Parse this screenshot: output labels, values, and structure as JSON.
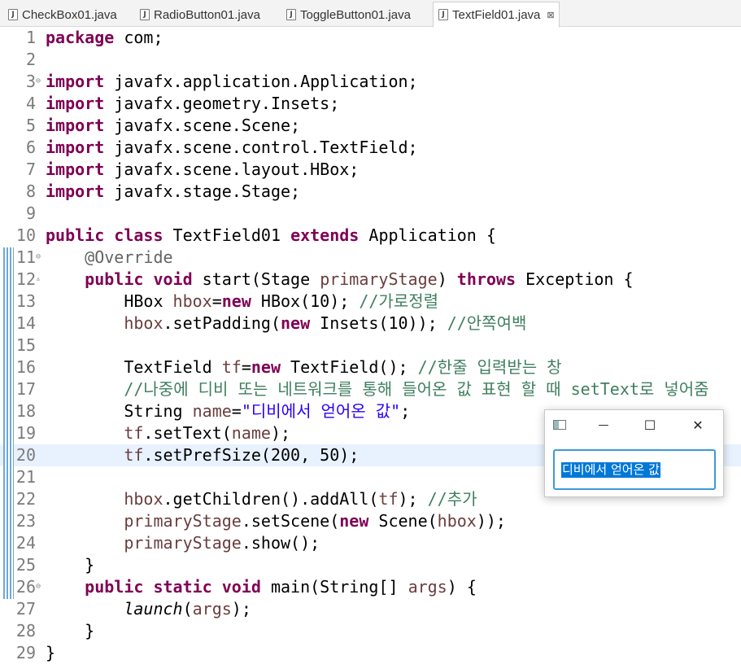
{
  "tabs": [
    {
      "label": "CheckBox01.java",
      "active": false
    },
    {
      "label": "RadioButton01.java",
      "active": false
    },
    {
      "label": "ToggleButton01.java",
      "active": false
    },
    {
      "label": "TextField01.java",
      "active": true,
      "close": "⊠"
    }
  ],
  "editor": {
    "current_line": 20,
    "lines": [
      {
        "n": "1",
        "tokens": [
          {
            "t": "package",
            "c": "kw"
          },
          {
            "t": " com;"
          }
        ]
      },
      {
        "n": "2",
        "tokens": []
      },
      {
        "n": "3",
        "fold": "⊖",
        "tokens": [
          {
            "t": "import",
            "c": "kw"
          },
          {
            "t": " javafx.application.Application;"
          }
        ]
      },
      {
        "n": "4",
        "tokens": [
          {
            "t": "import",
            "c": "kw"
          },
          {
            "t": " javafx.geometry.Insets;"
          }
        ]
      },
      {
        "n": "5",
        "tokens": [
          {
            "t": "import",
            "c": "kw"
          },
          {
            "t": " javafx.scene.Scene;"
          }
        ]
      },
      {
        "n": "6",
        "tokens": [
          {
            "t": "import",
            "c": "kw"
          },
          {
            "t": " javafx.scene.control.TextField;"
          }
        ]
      },
      {
        "n": "7",
        "tokens": [
          {
            "t": "import",
            "c": "kw"
          },
          {
            "t": " javafx.scene.layout.HBox;"
          }
        ]
      },
      {
        "n": "8",
        "tokens": [
          {
            "t": "import",
            "c": "kw"
          },
          {
            "t": " javafx.stage.Stage;"
          }
        ]
      },
      {
        "n": "9",
        "tokens": []
      },
      {
        "n": "10",
        "tokens": [
          {
            "t": "public",
            "c": "kw"
          },
          {
            "t": " "
          },
          {
            "t": "class",
            "c": "kw"
          },
          {
            "t": " TextField01 "
          },
          {
            "t": "extends",
            "c": "kw"
          },
          {
            "t": " Application {"
          }
        ]
      },
      {
        "n": "11",
        "fold": "⊖",
        "tokens": [
          {
            "t": "    "
          },
          {
            "t": "@Override",
            "c": "ann"
          }
        ]
      },
      {
        "n": "12",
        "fold": "▵",
        "tokens": [
          {
            "t": "    "
          },
          {
            "t": "public",
            "c": "kw"
          },
          {
            "t": " "
          },
          {
            "t": "void",
            "c": "kw"
          },
          {
            "t": " start(Stage "
          },
          {
            "t": "primaryStage",
            "c": "fld"
          },
          {
            "t": ") "
          },
          {
            "t": "throws",
            "c": "kw"
          },
          {
            "t": " Exception {"
          }
        ]
      },
      {
        "n": "13",
        "tokens": [
          {
            "t": "        HBox "
          },
          {
            "t": "hbox",
            "c": "fld"
          },
          {
            "t": "="
          },
          {
            "t": "new",
            "c": "kw"
          },
          {
            "t": " HBox(10); "
          },
          {
            "t": "//가로정렬",
            "c": "cm"
          }
        ]
      },
      {
        "n": "14",
        "tokens": [
          {
            "t": "        "
          },
          {
            "t": "hbox",
            "c": "fld"
          },
          {
            "t": ".setPadding("
          },
          {
            "t": "new",
            "c": "kw"
          },
          {
            "t": " Insets(10)); "
          },
          {
            "t": "//안쪽여백",
            "c": "cm"
          }
        ]
      },
      {
        "n": "15",
        "tokens": []
      },
      {
        "n": "16",
        "tokens": [
          {
            "t": "        TextField "
          },
          {
            "t": "tf",
            "c": "fld"
          },
          {
            "t": "="
          },
          {
            "t": "new",
            "c": "kw"
          },
          {
            "t": " TextField(); "
          },
          {
            "t": "//한줄 입력받는 창",
            "c": "cm"
          }
        ]
      },
      {
        "n": "17",
        "tokens": [
          {
            "t": "        "
          },
          {
            "t": "//나중에 디비 또는 네트워크를 통해 들어온 값 표현 할 때 setText로 넣어줌",
            "c": "cm"
          }
        ]
      },
      {
        "n": "18",
        "tokens": [
          {
            "t": "        String "
          },
          {
            "t": "name",
            "c": "fld"
          },
          {
            "t": "="
          },
          {
            "t": "\"디비에서 얻어온 값\"",
            "c": "str"
          },
          {
            "t": ";"
          }
        ]
      },
      {
        "n": "19",
        "tokens": [
          {
            "t": "        "
          },
          {
            "t": "tf",
            "c": "fld"
          },
          {
            "t": ".setText("
          },
          {
            "t": "name",
            "c": "fld"
          },
          {
            "t": ");"
          }
        ]
      },
      {
        "n": "20",
        "tokens": [
          {
            "t": "        "
          },
          {
            "t": "tf",
            "c": "fld"
          },
          {
            "t": ".setPrefSize(200, 50);"
          }
        ]
      },
      {
        "n": "21",
        "tokens": []
      },
      {
        "n": "22",
        "tokens": [
          {
            "t": "        "
          },
          {
            "t": "hbox",
            "c": "fld"
          },
          {
            "t": ".getChildren().addAll("
          },
          {
            "t": "tf",
            "c": "fld"
          },
          {
            "t": "); "
          },
          {
            "t": "//추가",
            "c": "cm"
          }
        ]
      },
      {
        "n": "23",
        "tokens": [
          {
            "t": "        "
          },
          {
            "t": "primaryStage",
            "c": "fld"
          },
          {
            "t": ".setScene("
          },
          {
            "t": "new",
            "c": "kw"
          },
          {
            "t": " Scene("
          },
          {
            "t": "hbox",
            "c": "fld"
          },
          {
            "t": "));"
          }
        ]
      },
      {
        "n": "24",
        "tokens": [
          {
            "t": "        "
          },
          {
            "t": "primaryStage",
            "c": "fld"
          },
          {
            "t": ".show();"
          }
        ]
      },
      {
        "n": "25",
        "tokens": [
          {
            "t": "    }"
          }
        ]
      },
      {
        "n": "26",
        "fold": "⊖",
        "tokens": [
          {
            "t": "    "
          },
          {
            "t": "public",
            "c": "kw"
          },
          {
            "t": " "
          },
          {
            "t": "static",
            "c": "kw"
          },
          {
            "t": " "
          },
          {
            "t": "void",
            "c": "kw"
          },
          {
            "t": " main(String[] "
          },
          {
            "t": "args",
            "c": "fld"
          },
          {
            "t": ") {"
          }
        ]
      },
      {
        "n": "27",
        "tokens": [
          {
            "t": "        "
          },
          {
            "t": "launch",
            "c": "it"
          },
          {
            "t": "("
          },
          {
            "t": "args",
            "c": "fld"
          },
          {
            "t": ");"
          }
        ]
      },
      {
        "n": "28",
        "tokens": [
          {
            "t": "    }"
          }
        ]
      },
      {
        "n": "29",
        "tokens": [
          {
            "t": "}"
          }
        ]
      }
    ]
  },
  "popup": {
    "minimize": "—",
    "maximize": "☐",
    "close": "✕",
    "textfield_value": "디비에서 얻어온 값"
  }
}
